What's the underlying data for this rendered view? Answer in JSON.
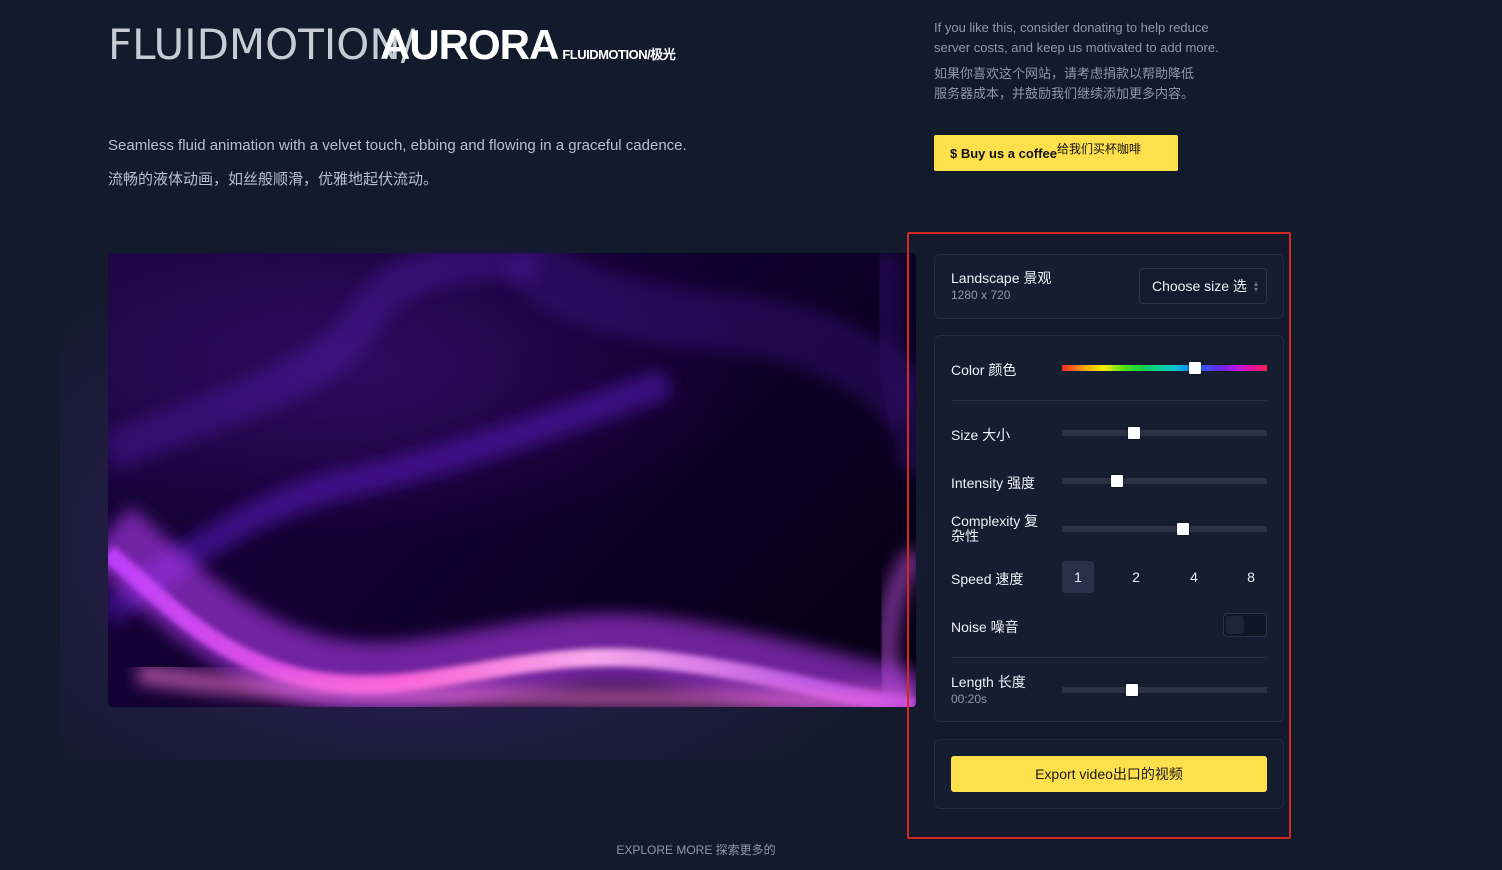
{
  "header": {
    "title_light": "FLUIDMOTION/",
    "title_bold": "AURORA",
    "title_sub": "FLUIDMOTION/极光",
    "description_en": "Seamless fluid animation with a velvet touch, ebbing and flowing in a graceful cadence.",
    "description_zh": "流畅的液体动画，如丝般顺滑，优雅地起伏流动。"
  },
  "donate": {
    "text_en_line1": "If you like this, consider donating to help reduce",
    "text_en_line2": "server costs, and keep us motivated to add more.",
    "text_zh_line1": "如果你喜欢这个网站，请考虑捐款以帮助降低",
    "text_zh_line2": "服务器成本，并鼓励我们继续添加更多内容。",
    "button_label": "$ Buy us a coffee",
    "button_label_zh": "给我们买杯咖啡",
    "button_color": "#fde04b"
  },
  "size_card": {
    "label": "Landscape 景观",
    "dimensions": "1280 x 720",
    "select_value": "Choose size 选"
  },
  "controls": {
    "color_label": "Color 颜色",
    "color_value": 0.65,
    "size_label": "Size 大小",
    "size_value": 0.35,
    "intensity_label": "Intensity 强度",
    "intensity_value": 0.27,
    "complexity_label_line1": "Complexity 复",
    "complexity_label_line2": "杂性",
    "complexity_value": 0.59,
    "speed_label": "Speed 速度",
    "speed_options": [
      "1",
      "2",
      "4",
      "8"
    ],
    "speed_selected": "1",
    "noise_label": "Noise 噪音",
    "noise_on": false,
    "length_label": "Length 长度",
    "length_value_text": "00:20s",
    "length_value": 0.34
  },
  "export": {
    "button_label": "Export video出口的视频",
    "button_color": "#fde04b"
  },
  "footer": {
    "explore_label": "EXPLORE MORE 探索更多的"
  },
  "colors": {
    "background": "#121a2c",
    "panel_highlight": "#d02a22",
    "aurora_pink": "#ff5ad0",
    "aurora_purple": "#8a2be2"
  }
}
